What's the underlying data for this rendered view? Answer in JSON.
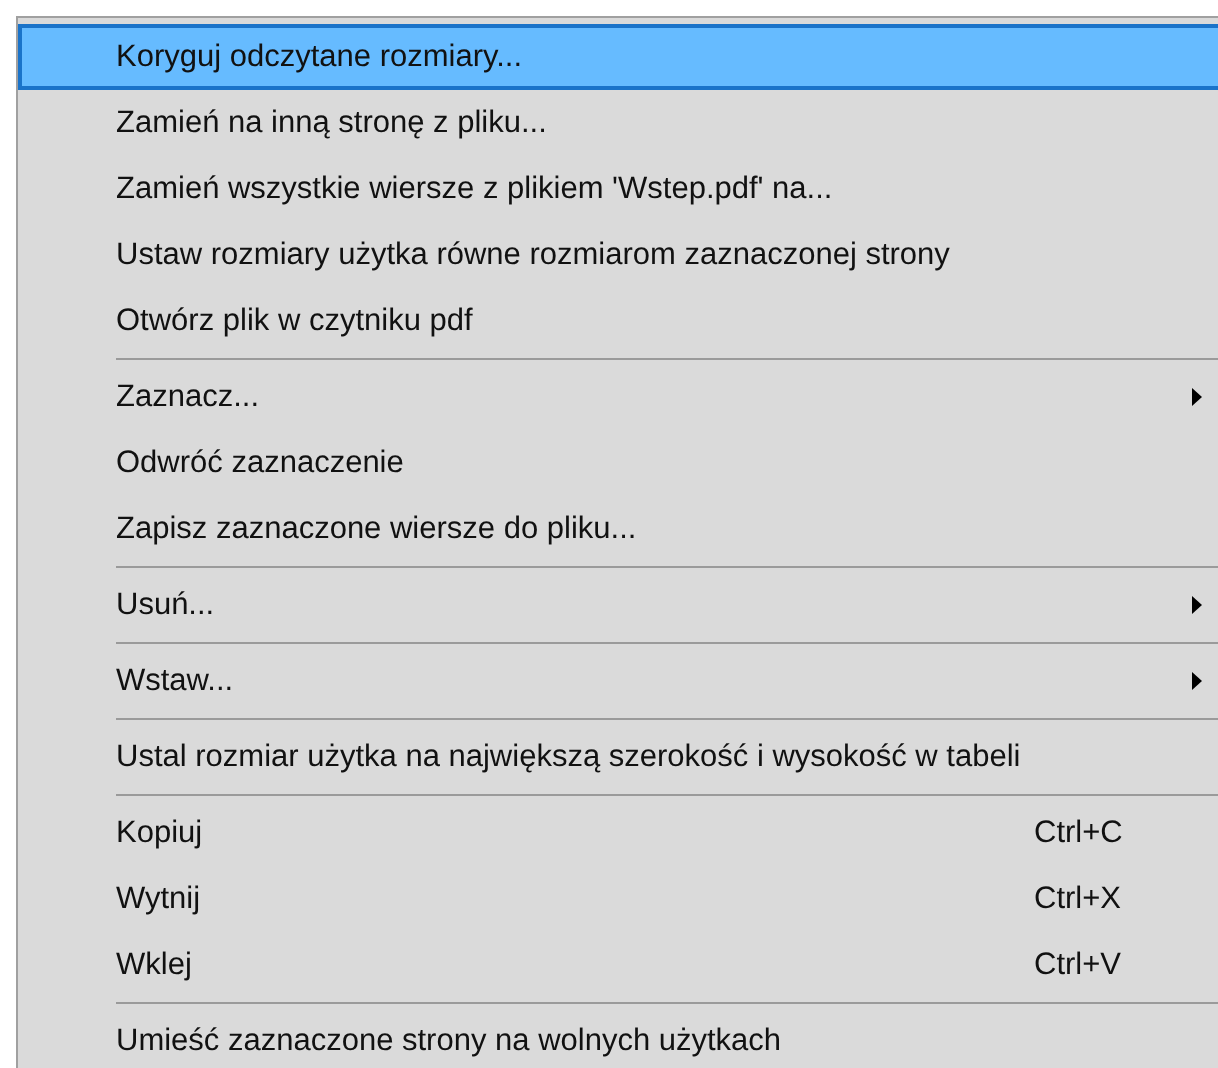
{
  "menu": {
    "groups": [
      {
        "items": [
          {
            "label": "Koryguj odczytane rozmiary...",
            "selected": true,
            "submenu": false
          },
          {
            "label": "Zamień na inną stronę z pliku...",
            "selected": false,
            "submenu": false
          },
          {
            "label": "Zamień wszystkie wiersze z plikiem 'Wstep.pdf' na...",
            "selected": false,
            "submenu": false
          },
          {
            "label": "Ustaw rozmiary użytka równe rozmiarom zaznaczonej strony",
            "selected": false,
            "submenu": false
          },
          {
            "label": "Otwórz plik w czytniku pdf",
            "selected": false,
            "submenu": false
          }
        ]
      },
      {
        "items": [
          {
            "label": "Zaznacz...",
            "selected": false,
            "submenu": true
          },
          {
            "label": "Odwróć zaznaczenie",
            "selected": false,
            "submenu": false
          },
          {
            "label": "Zapisz zaznaczone wiersze do pliku...",
            "selected": false,
            "submenu": false
          }
        ]
      },
      {
        "items": [
          {
            "label": "Usuń...",
            "selected": false,
            "submenu": true
          }
        ]
      },
      {
        "items": [
          {
            "label": "Wstaw...",
            "selected": false,
            "submenu": true
          }
        ]
      },
      {
        "items": [
          {
            "label": "Ustal rozmiar użytka na największą szerokość i wysokość w tabeli",
            "selected": false,
            "submenu": false
          }
        ]
      },
      {
        "items": [
          {
            "label": "Kopiuj",
            "shortcut": "Ctrl+C",
            "selected": false,
            "submenu": false
          },
          {
            "label": "Wytnij",
            "shortcut": "Ctrl+X",
            "selected": false,
            "submenu": false
          },
          {
            "label": "Wklej",
            "shortcut": "Ctrl+V",
            "selected": false,
            "submenu": false
          }
        ]
      },
      {
        "items": [
          {
            "label": "Umieść zaznaczone strony na wolnych użytkach",
            "selected": false,
            "submenu": false
          }
        ]
      }
    ]
  }
}
